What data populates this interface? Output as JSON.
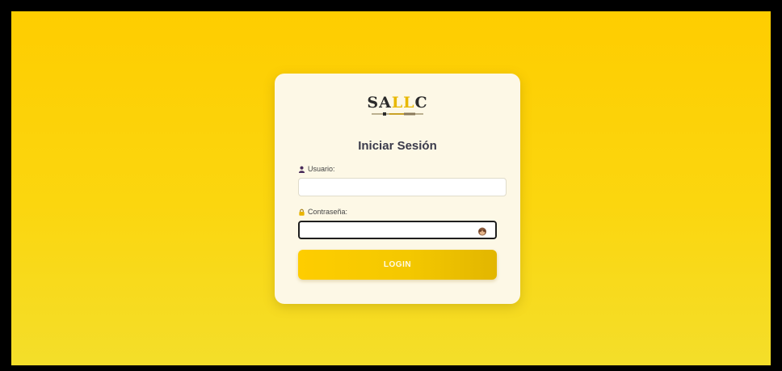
{
  "logo": {
    "text_prefix": "SA",
    "text_accent": "LL",
    "text_suffix": "C"
  },
  "login": {
    "title": "Iniciar Sesión",
    "username_label": "Usuario:",
    "username_value": "",
    "password_label": "Contraseña:",
    "password_value": "",
    "button_label": "LOGIN"
  },
  "icons": {
    "username": "user-icon",
    "password": "lock-icon",
    "toggle_password": "monkey-see-no-evil-icon"
  },
  "colors": {
    "background_top": "#fecd00",
    "background_bottom": "#f4de2a",
    "card": "#fdf8e6",
    "accent": "#e8b800",
    "button": "#f4c800"
  }
}
